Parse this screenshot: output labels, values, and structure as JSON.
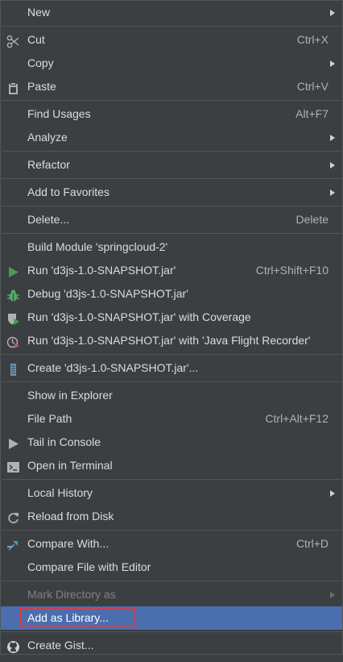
{
  "menu": {
    "items": [
      {
        "label": "New",
        "submenu": true
      },
      {
        "label": "Cut",
        "shortcut": "Ctrl+X",
        "icon": "scissors-icon"
      },
      {
        "label": "Copy",
        "submenu": true
      },
      {
        "label": "Paste",
        "shortcut": "Ctrl+V",
        "icon": "clipboard-icon"
      },
      {
        "label": "Find Usages",
        "shortcut": "Alt+F7"
      },
      {
        "label": "Analyze",
        "submenu": true
      },
      {
        "label": "Refactor",
        "submenu": true
      },
      {
        "label": "Add to Favorites",
        "submenu": true
      },
      {
        "label": "Delete...",
        "shortcut": "Delete"
      },
      {
        "label": "Build Module 'springcloud-2'"
      },
      {
        "label": "Run 'd3js-1.0-SNAPSHOT.jar'",
        "shortcut": "Ctrl+Shift+F10",
        "icon": "run-icon"
      },
      {
        "label": "Debug 'd3js-1.0-SNAPSHOT.jar'",
        "icon": "debug-bug-icon"
      },
      {
        "label": "Run 'd3js-1.0-SNAPSHOT.jar' with Coverage",
        "icon": "coverage-shield-icon"
      },
      {
        "label": "Run 'd3js-1.0-SNAPSHOT.jar' with 'Java Flight Recorder'",
        "icon": "profiler-icon"
      },
      {
        "label": "Create 'd3js-1.0-SNAPSHOT.jar'...",
        "icon": "jar-artifact-icon"
      },
      {
        "label": "Show in Explorer"
      },
      {
        "label": "File Path",
        "shortcut": "Ctrl+Alt+F12"
      },
      {
        "label": "Tail in Console",
        "icon": "tail-play-icon"
      },
      {
        "label": "Open in Terminal",
        "icon": "terminal-icon"
      },
      {
        "label": "Local History",
        "submenu": true
      },
      {
        "label": "Reload from Disk",
        "icon": "reload-icon"
      },
      {
        "label": "Compare With...",
        "shortcut": "Ctrl+D",
        "icon": "compare-arrows-icon"
      },
      {
        "label": "Compare File with Editor"
      },
      {
        "label": "Mark Directory as",
        "submenu": true,
        "disabled": true
      },
      {
        "label": "Add as Library...",
        "selected": true
      },
      {
        "label": "Create Gist...",
        "icon": "github-icon"
      }
    ]
  },
  "colors": {
    "background": "#3c3f41",
    "selected": "#4b6eaf",
    "highlight_border": "#e8373c",
    "run_green": "#499c54",
    "debug_green": "#59a869",
    "compare_blue": "#389fd6"
  }
}
